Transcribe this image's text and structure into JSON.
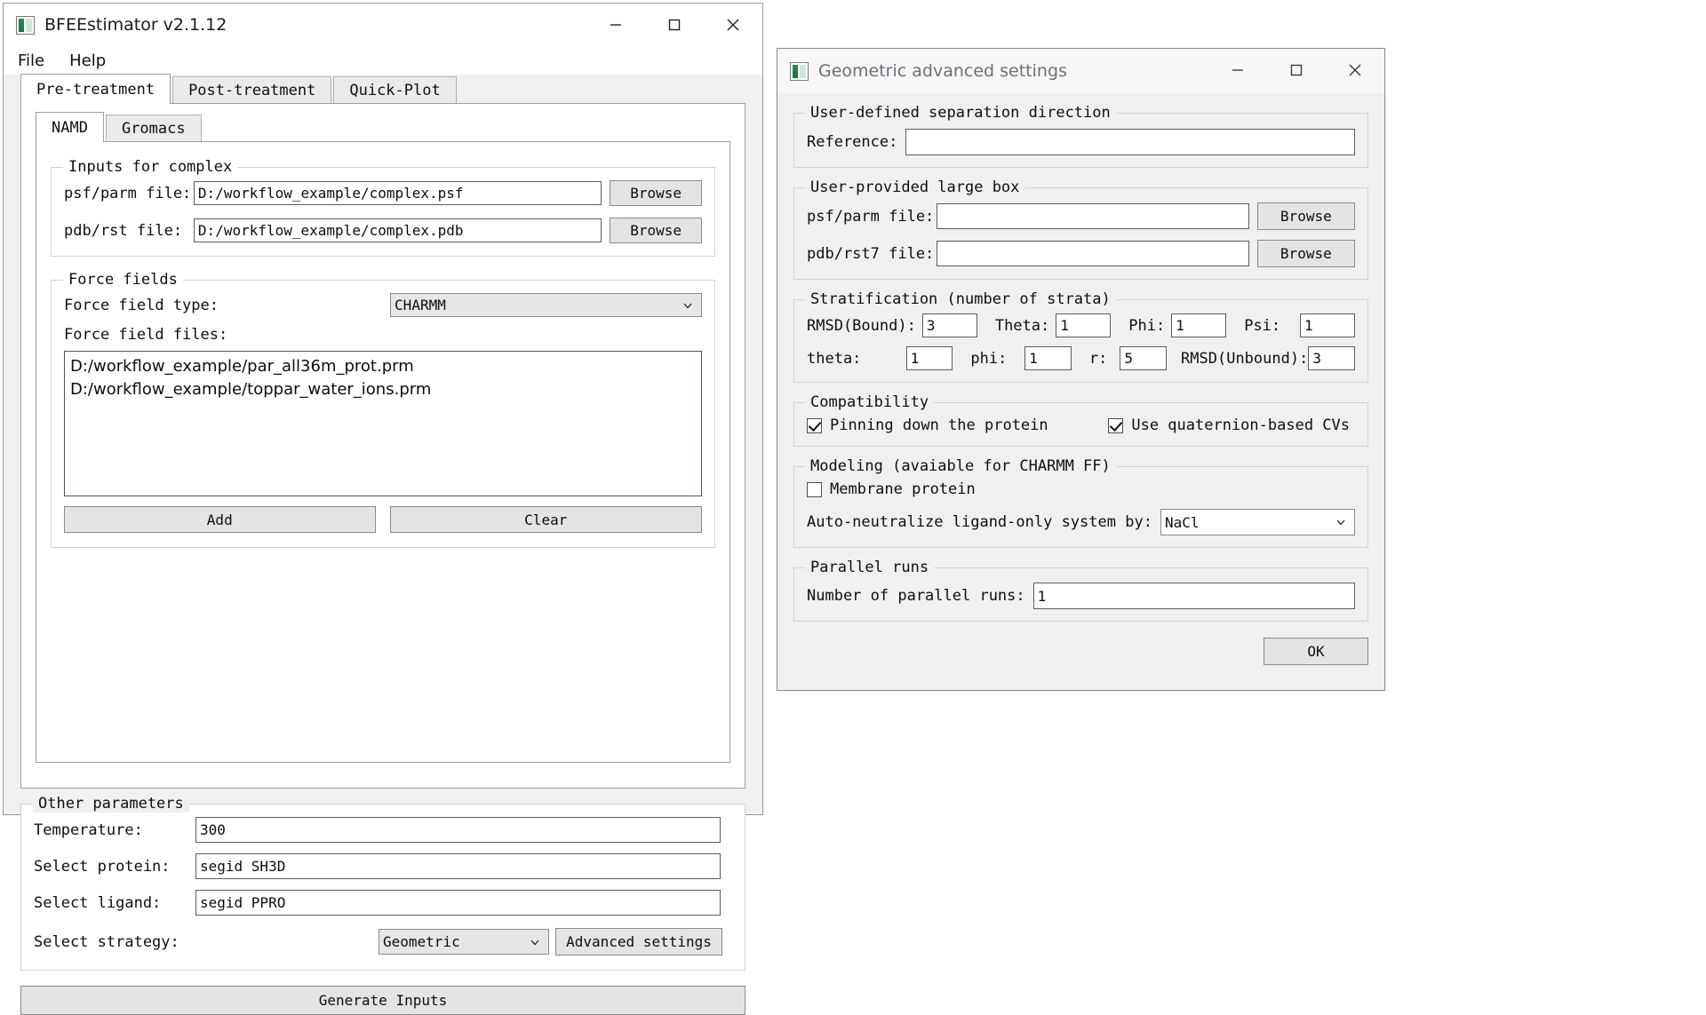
{
  "main_window": {
    "title": "BFEEstimator v2.1.12",
    "icon": "app-icon",
    "window_controls": {
      "minimize": "minimize-icon",
      "maximize": "maximize-icon",
      "close": "close-icon"
    },
    "menu": [
      "File",
      "Help"
    ],
    "tabs": [
      {
        "label": "Pre-treatment",
        "active": true
      },
      {
        "label": "Post-treatment",
        "active": false
      },
      {
        "label": "Quick-Plot",
        "active": false
      }
    ],
    "inner_tabs": [
      {
        "label": "NAMD",
        "active": true
      },
      {
        "label": "Gromacs",
        "active": false
      }
    ],
    "inputs_group": {
      "legend": "Inputs for complex",
      "rows": [
        {
          "label": "psf/parm file:",
          "value": "D:/workflow_example/complex.psf",
          "button": "Browse"
        },
        {
          "label": "pdb/rst file:",
          "value": "D:/workflow_example/complex.pdb",
          "button": "Browse"
        }
      ]
    },
    "force_fields_group": {
      "legend": "Force fields",
      "type_label": "Force field type:",
      "type_value": "CHARMM",
      "files_label": "Force field files:",
      "files": [
        "D:/workflow_example/par_all36m_prot.prm",
        "D:/workflow_example/toppar_water_ions.prm"
      ],
      "add_button": "Add",
      "clear_button": "Clear"
    },
    "other_params_group": {
      "legend": "Other parameters",
      "temperature_label": "Temperature:",
      "temperature_value": "300",
      "protein_label": "Select protein:",
      "protein_value": "segid SH3D",
      "ligand_label": "Select ligand:",
      "ligand_value": "segid PPRO",
      "strategy_label": "Select strategy:",
      "strategy_value": "Geometric",
      "advanced_button": "Advanced settings"
    },
    "generate_button": "Generate Inputs"
  },
  "dialog": {
    "title": "Geometric advanced settings",
    "icon": "app-icon",
    "window_controls": {
      "minimize": "minimize-icon",
      "maximize": "maximize-icon",
      "close": "close-icon"
    },
    "separation_group": {
      "legend": "User-defined separation direction",
      "reference_label": "Reference:",
      "reference_value": ""
    },
    "large_box_group": {
      "legend": "User-provided large box",
      "rows": [
        {
          "label": "psf/parm file:",
          "value": "",
          "button": "Browse"
        },
        {
          "label": "pdb/rst7 file:",
          "value": "",
          "button": "Browse"
        }
      ]
    },
    "stratification_group": {
      "legend": "Stratification (number of strata)",
      "fields": [
        {
          "label": "RMSD(Bound):",
          "value": "3"
        },
        {
          "label": "Theta:",
          "value": "1"
        },
        {
          "label": "Phi:",
          "value": "1"
        },
        {
          "label": "Psi:",
          "value": "1"
        },
        {
          "label": "theta:",
          "value": "1"
        },
        {
          "label": "phi:",
          "value": "1"
        },
        {
          "label": "r:",
          "value": "5"
        },
        {
          "label": "RMSD(Unbound):",
          "value": "3"
        }
      ]
    },
    "compatibility_group": {
      "legend": "Compatibility",
      "checkboxes": [
        {
          "label": "Pinning down the protein",
          "checked": true
        },
        {
          "label": "Use quaternion-based CVs",
          "checked": true
        }
      ]
    },
    "modeling_group": {
      "legend": "Modeling (avaiable for CHARMM FF)",
      "membrane_label": "Membrane protein",
      "membrane_checked": false,
      "neutralize_label": "Auto-neutralize ligand-only system by:",
      "neutralize_value": "NaCl"
    },
    "parallel_group": {
      "legend": "Parallel runs",
      "runs_label": "Number of parallel runs:",
      "runs_value": "1"
    },
    "ok_button": "OK"
  }
}
